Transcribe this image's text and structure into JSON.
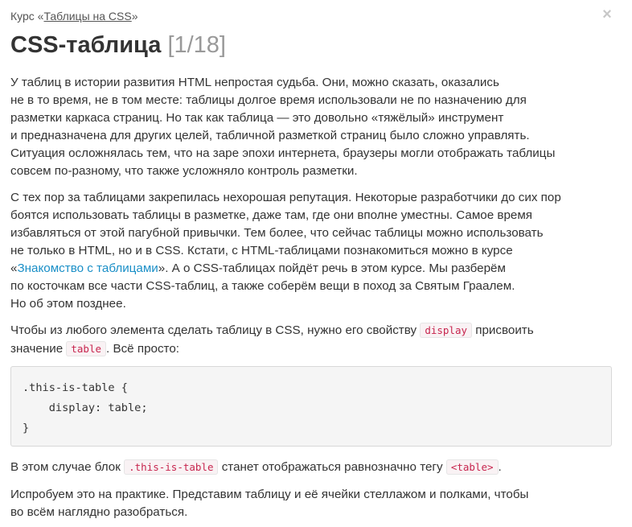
{
  "header": {
    "course_prefix": "Курс «",
    "course_link": "Таблицы на CSS",
    "course_suffix": "»",
    "close_symbol": "×"
  },
  "title": {
    "text": "CSS-таблица",
    "counter": "[1/18]"
  },
  "paragraphs": {
    "p1": [
      "У таблиц в истории развития HTML непростая судьба. Они, можно сказать, оказались",
      "не в то время, не в том месте: таблицы долгое время использовали не по назначению для",
      "разметки каркаса страниц. Но так как таблица — это довольно «тяжёлый» инструмент",
      "и предназначена для других целей, табличной разметкой страниц было сложно управлять.",
      "Ситуация осложнялась тем, что на заре эпохи интернета, браузеры могли отображать таблицы",
      "совсем по-разному, что также усложняло контроль разметки."
    ],
    "p2": {
      "lines_before": [
        "С тех пор за таблицами закрепилась нехорошая репутация. Некоторые разработчики до сих пор",
        "боятся использовать таблицы в разметке, даже там, где они вполне уместны. Самое время",
        "избавляться от этой пагубной привычки. Тем более, что сейчас таблицы можно использовать",
        "не только в HTML, но и в CSS. Кстати, с HTML-таблицами познакомиться можно в курсе"
      ],
      "link_prefix": "«",
      "link_text": "Знакомство с таблицами",
      "link_suffix": "». А о CSS-таблицах пойдёт речь в этом курсе. Мы разберём",
      "lines_after": [
        "по косточкам все части CSS-таблиц, а также соберём вещи в поход за Святым Граалем.",
        "Но об этом позднее."
      ]
    },
    "p3": {
      "part1": "Чтобы из любого элемента сделать таблицу в CSS, нужно его свойству",
      "code1": "display",
      "part2": "присвоить",
      "part3": "значение",
      "code2": "table",
      "part4": ". Всё просто:"
    },
    "p4": {
      "part1": "В этом случае блок",
      "code1": ".this-is-table",
      "part2": "станет отображаться равнозначно тегу",
      "code2": "<table>",
      "part3": "."
    },
    "p5": [
      "Испробуем это на практике. Представим таблицу и её ячейки стеллажом и полками, чтобы",
      "во всём наглядно разобраться."
    ]
  },
  "code_block": [
    ".this-is-table {",
    "    display: table;",
    "}"
  ]
}
